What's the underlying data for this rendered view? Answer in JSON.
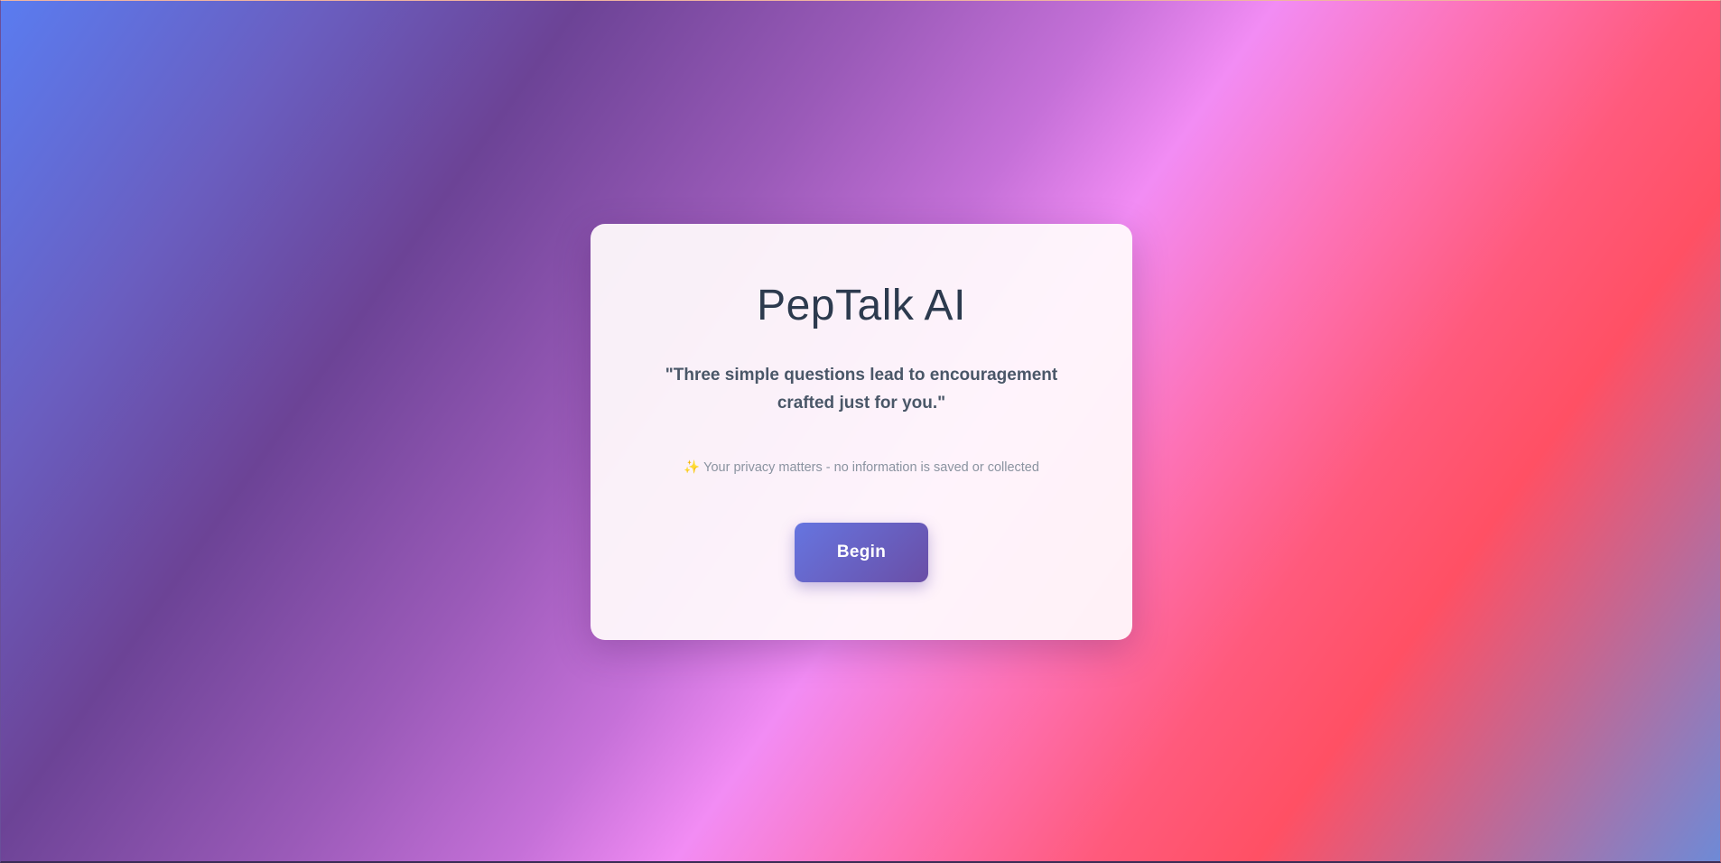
{
  "app": {
    "title": "PepTalk AI"
  },
  "intro": {
    "tagline": "\"Three simple questions lead to encouragement crafted just for you.\"",
    "privacy_icon": "✨",
    "privacy_icon_name": "sparkles-icon",
    "privacy_text": "Your privacy matters - no information is saved or collected"
  },
  "actions": {
    "begin_label": "Begin"
  },
  "colors": {
    "title": "#2c3a4e",
    "tagline": "#4a5768",
    "privacy": "#8a93a0",
    "button_start": "#6675e0",
    "button_end": "#6a4ea6",
    "background_stops": [
      "#5a7cf0",
      "#6c4396",
      "#f28cf4",
      "#ff5064",
      "#6e8ad6"
    ]
  }
}
